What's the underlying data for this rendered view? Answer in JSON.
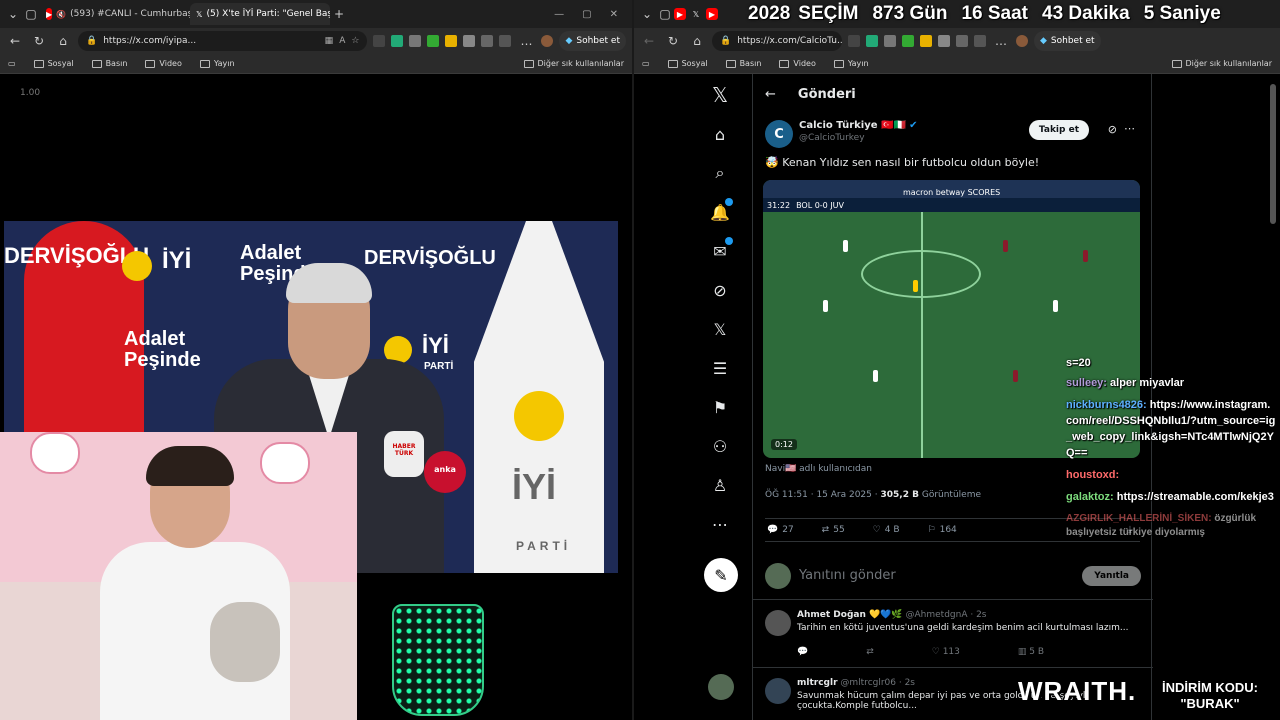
{
  "left_window": {
    "tabs": [
      {
        "icon": "youtube-icon",
        "label": "(593) #CANLI - Cumhurbaşka",
        "active": false,
        "muted": true
      },
      {
        "icon": "x-icon",
        "label": "(5) X'te İYİ Parti: \"Genel Başkan",
        "active": true
      }
    ],
    "url": "https://x.com/iyipa...",
    "copilot_label": "Sohbet et",
    "bookmarks": [
      "Sosyal",
      "Basın",
      "Video",
      "Yayın"
    ],
    "bookmarks_other": "Diğer sık kullanılanlar",
    "speed_label": "1.00",
    "backdrop_texts": [
      "DERVİŞOĞLU",
      "İYİ",
      "Adalet Peşinde",
      "Adalet Peşinde",
      "DERVİŞOĞLU",
      "İYİ",
      "PARTİ",
      "İYİ",
      "PARTİ"
    ],
    "mic_labels": [
      "HABER TÜRK",
      "anka"
    ]
  },
  "right_window": {
    "url": "https://x.com/CalcioTu...",
    "copilot_label": "Sohbet et",
    "bookmarks": [
      "Sosyal",
      "Basın",
      "Video",
      "Yayın"
    ],
    "bookmarks_other": "Diğer sık kullanılanlar",
    "page_title": "Gönderi",
    "author_name": "Calcio Türkiye 🇹🇷🇮🇹",
    "author_handle": "@CalcioTurkey",
    "follow_label": "Takip et",
    "post_text": "🤯 Kenan Yıldız sen nasıl bir futbolcu oldun böyle!",
    "video_score": "BOL 0-0 JUV",
    "video_clock": "31:22",
    "video_ad": "macron   betway   SCORES",
    "video_duration": "0:12",
    "translate_text": "Navi🇺🇸  adlı kullanıcıdan",
    "meta_time": "ÖĞ 11:51 · 15 Ara 2025 ·",
    "meta_views": "305,2 B",
    "meta_views_label": "Görüntüleme",
    "actions": {
      "replies": "27",
      "reposts": "55",
      "likes": "4 B",
      "bookmarks": "164"
    },
    "reply_placeholder": "Yanıtını gönder",
    "reply_button": "Yanıtla",
    "comments": [
      {
        "name": "Ahmet Doğan 💛💙🌿",
        "handle": "@AhmetdgnA · 2s",
        "text": "Tarihin en kötü juventus'una geldi kardeşim benim acil kurtulması lazım...",
        "likes": "113",
        "views": "5 B"
      },
      {
        "name": "mltrcglr",
        "handle": "@mltrcglr06 · 2s",
        "text": "Savunmak hücum çalım depar iyi pas ve orta golcülük herşeyiyle çocukta.Komple futbolcu..."
      }
    ]
  },
  "overlay": {
    "countdown": [
      "2028",
      "SEÇİM",
      "873 Gün",
      "16 Saat",
      "43 Dakika",
      "5 Saniye"
    ],
    "chat": [
      {
        "user": "",
        "text": "s=20"
      },
      {
        "user": "sulleey:",
        "text": "alper miyavlar"
      },
      {
        "user": "nickburns4826:",
        "text": "https://www.instagram.com/reel/DSSHQNbIlu1/?utm_source=ig_web_copy_link&igsh=NTc4MTlwNjQ2YQ=="
      },
      {
        "user": "houstoxd:",
        "text": ""
      },
      {
        "user": "galaktoz:",
        "text": "https://streamable.com/kekje3"
      },
      {
        "user": "AZGIRLIK_HALLERİNİ_SİKEN:",
        "text": "özgürlük başlıyetsiz türkiye diyolarmış"
      }
    ],
    "sponsor": "WRAITH.",
    "promo_label": "İNDİRİM KODU:",
    "promo_code": "\"BURAK\""
  }
}
